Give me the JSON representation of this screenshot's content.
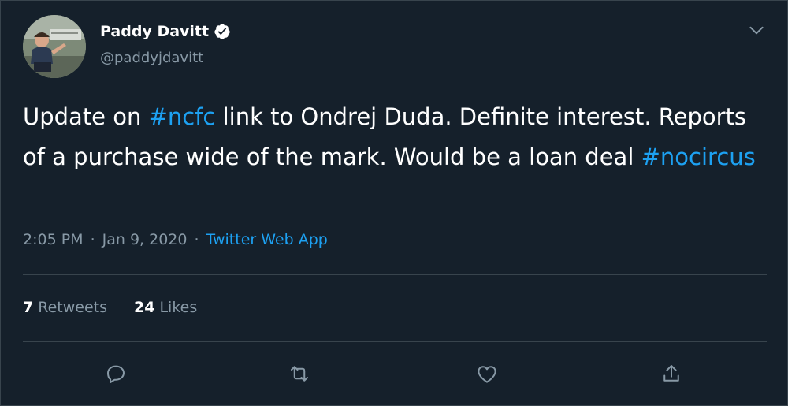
{
  "tweet": {
    "author": {
      "display_name": "Paddy Davitt",
      "handle": "@paddyjdavitt",
      "verified": true
    },
    "text_segments": [
      {
        "text": "Update on ",
        "type": "text"
      },
      {
        "text": "#ncfc",
        "type": "hashtag"
      },
      {
        "text": " link to Ondrej Duda. Definite interest. Reports of a purchase wide of the mark. Would be a loan deal ",
        "type": "text"
      },
      {
        "text": "#nocircus",
        "type": "hashtag"
      }
    ],
    "time": "2:05 PM",
    "date": "Jan 9, 2020",
    "separator": "·",
    "source": "Twitter Web App",
    "stats": {
      "retweets_count": "7",
      "retweets_label": "Retweets",
      "likes_count": "24",
      "likes_label": "Likes"
    },
    "actions": [
      "reply-icon",
      "retweet-icon",
      "like-icon",
      "share-icon"
    ]
  },
  "colors": {
    "background": "#15202b",
    "border": "#38444d",
    "text_primary": "#ffffff",
    "text_secondary": "#8899a6",
    "accent": "#1da1f2"
  }
}
